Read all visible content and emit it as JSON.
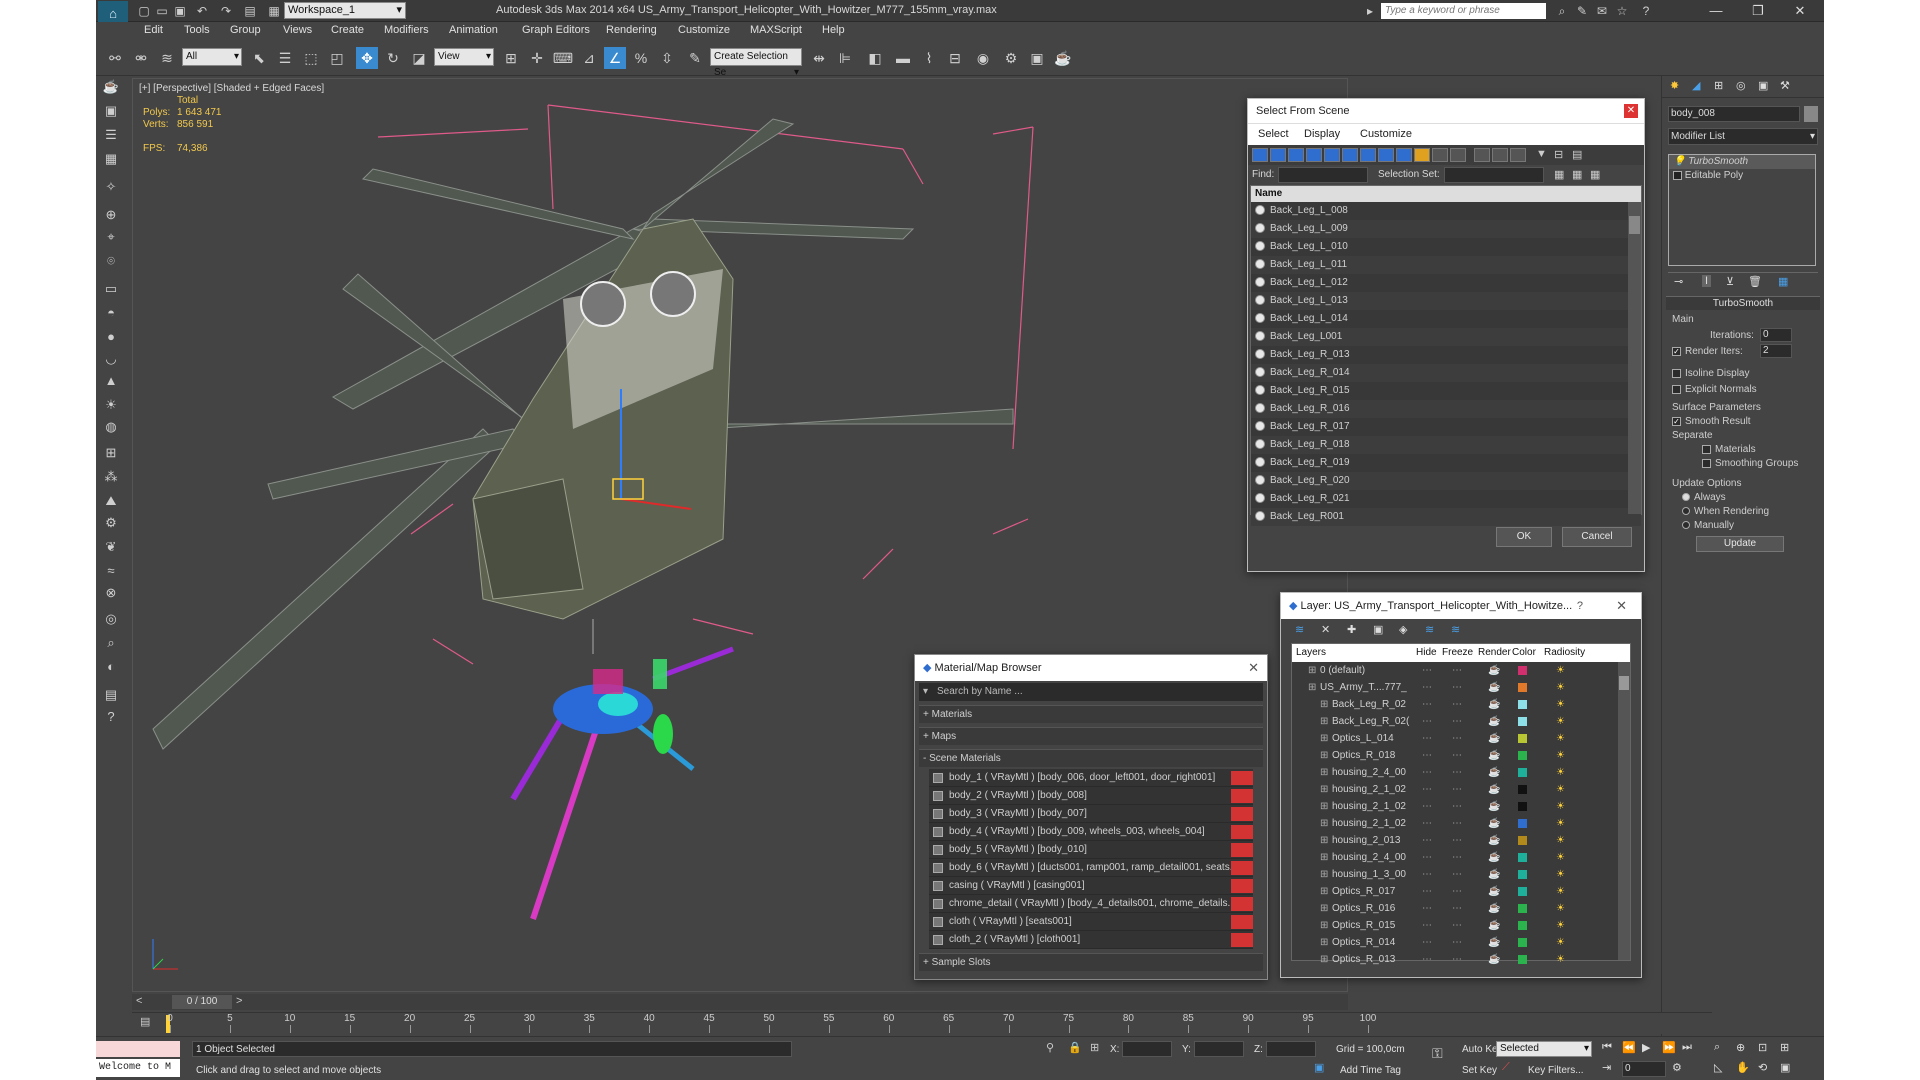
{
  "app": {
    "title": "Autodesk 3ds Max  2014 x64     US_Army_Transport_Helicopter_With_Howitzer_M777_155mm_vray.max",
    "workspace": "Workspace_1",
    "search_placeholder": "Type a keyword or phrase"
  },
  "menu": [
    "Edit",
    "Tools",
    "Group",
    "Views",
    "Create",
    "Modifiers",
    "Animation",
    "Graph Editors",
    "Rendering",
    "Customize",
    "MAXScript",
    "Help"
  ],
  "toolbar": {
    "filter": "All",
    "refcoord": "View",
    "selset": "Create Selection Se"
  },
  "viewport": {
    "label": "[+] [Perspective] [Shaded + Edged Faces]",
    "stats_header": "Total",
    "polys_label": "Polys:",
    "polys": "1 643 471",
    "verts_label": "Verts:",
    "verts": "856 591",
    "fps_label": "FPS:",
    "fps": "74,386"
  },
  "select_from_scene": {
    "title": "Select From Scene",
    "menu": [
      "Select",
      "Display",
      "Customize"
    ],
    "find_label": "Find:",
    "selset_label": "Selection Set:",
    "col_name": "Name",
    "items": [
      "Back_Leg_L_008",
      "Back_Leg_L_009",
      "Back_Leg_L_010",
      "Back_Leg_L_011",
      "Back_Leg_L_012",
      "Back_Leg_L_013",
      "Back_Leg_L_014",
      "Back_Leg_L001",
      "Back_Leg_R_013",
      "Back_Leg_R_014",
      "Back_Leg_R_015",
      "Back_Leg_R_016",
      "Back_Leg_R_017",
      "Back_Leg_R_018",
      "Back_Leg_R_019",
      "Back_Leg_R_020",
      "Back_Leg_R_021",
      "Back_Leg_R001"
    ],
    "ok": "OK",
    "cancel": "Cancel"
  },
  "layer_dialog": {
    "title": "Layer: US_Army_Transport_Helicopter_With_Howitze...",
    "help": "?",
    "cols": [
      "Layers",
      "Hide",
      "Freeze",
      "Render",
      "Color",
      "Radiosity"
    ],
    "rows": [
      {
        "name": "0 (default)",
        "indent": 0,
        "color": "#d22f6e"
      },
      {
        "name": "US_Army_T....777_",
        "indent": 0,
        "color": "#e07a2a"
      },
      {
        "name": "Back_Leg_R_02",
        "indent": 1,
        "color": "#8ee0e8"
      },
      {
        "name": "Back_Leg_R_02(",
        "indent": 1,
        "color": "#8ee0e8"
      },
      {
        "name": "Optics_L_014",
        "indent": 1,
        "color": "#b8c634"
      },
      {
        "name": "Optics_R_018",
        "indent": 1,
        "color": "#2bb34e"
      },
      {
        "name": "housing_2_4_00",
        "indent": 1,
        "color": "#1fb09b"
      },
      {
        "name": "housing_2_1_02",
        "indent": 1,
        "color": "#111111"
      },
      {
        "name": "housing_2_1_02",
        "indent": 1,
        "color": "#111111"
      },
      {
        "name": "housing_2_1_02",
        "indent": 1,
        "color": "#2f6ecf"
      },
      {
        "name": "housing_2_013",
        "indent": 1,
        "color": "#b28a1b"
      },
      {
        "name": "housing_2_4_00",
        "indent": 1,
        "color": "#1fb09b"
      },
      {
        "name": "housing_1_3_00",
        "indent": 1,
        "color": "#1fb09b"
      },
      {
        "name": "Optics_R_017",
        "indent": 1,
        "color": "#1fb09b"
      },
      {
        "name": "Optics_R_016",
        "indent": 1,
        "color": "#2bb34e"
      },
      {
        "name": "Optics_R_015",
        "indent": 1,
        "color": "#2bb34e"
      },
      {
        "name": "Optics_R_014",
        "indent": 1,
        "color": "#2bb34e"
      },
      {
        "name": "Optics_R_013",
        "indent": 1,
        "color": "#2bb34e"
      }
    ]
  },
  "material_browser": {
    "title": "Material/Map Browser",
    "search_placeholder": "Search by Name ...",
    "sections": [
      "+ Materials",
      "+ Maps",
      "- Scene Materials"
    ],
    "materials": [
      "body_1  ( VRayMtl )  [body_006, door_left001, door_right001]",
      "body_2  ( VRayMtl )  [body_008]",
      "body_3  ( VRayMtl )  [body_007]",
      "body_4  ( VRayMtl )  [body_009, wheels_003, wheels_004]",
      "body_5  ( VRayMtl )  [body_010]",
      "body_6  ( VRayMtl )  [ducts001, ramp001, ramp_detail001, seats...",
      "casing  ( VRayMtl )  [casing001]",
      "chrome_detail  ( VRayMtl )  [body_4_details001, chrome_details...",
      "cloth  ( VRayMtl )  [seats001]",
      "cloth_2  ( VRayMtl )  [cloth001]"
    ],
    "sample_slots": "+ Sample Slots"
  },
  "command_panel": {
    "object_name": "body_008",
    "modifier_list": "Modifier List",
    "stack": [
      "TurboSmooth",
      "Editable Poly"
    ],
    "rollout_title": "TurboSmooth",
    "main_label": "Main",
    "iterations_label": "Iterations:",
    "iterations": "0",
    "render_iters_label": "Render Iters:",
    "render_iters": "2",
    "isoline": "Isoline Display",
    "explicit": "Explicit Normals",
    "surface_params": "Surface Parameters",
    "smooth_result": "Smooth Result",
    "separate": "Separate",
    "materials": "Materials",
    "smoothing_groups": "Smoothing Groups",
    "update_options": "Update Options",
    "always": "Always",
    "when_rendering": "When Rendering",
    "manually": "Manually",
    "update": "Update"
  },
  "timeline": {
    "frame": "0 / 100",
    "ticks": [
      "0",
      "5",
      "10",
      "15",
      "20",
      "25",
      "30",
      "35",
      "40",
      "45",
      "50",
      "55",
      "60",
      "65",
      "70",
      "75",
      "80",
      "85",
      "90",
      "95",
      "100"
    ]
  },
  "status": {
    "cmd1": "Welcome to M",
    "selected": "1 Object Selected",
    "hint": "Click and drag to select and move objects",
    "x_label": "X:",
    "y_label": "Y:",
    "z_label": "Z:",
    "grid": "Grid = 100,0cm",
    "add_time_tag": "Add Time Tag",
    "auto_key": "Auto Key",
    "set_key": "Set Key",
    "selected_dd": "Selected",
    "key_filters": "Key Filters...",
    "frame_field": "0"
  },
  "colors": {
    "accent": "#3a8ad0",
    "ui_bg": "#444444",
    "close_red": "#d33333"
  }
}
